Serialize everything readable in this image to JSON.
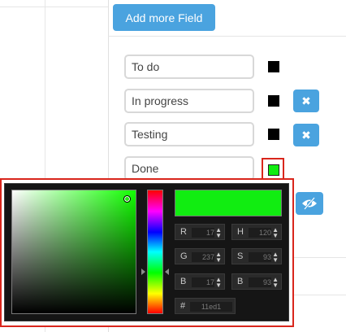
{
  "toolbar": {
    "add_field_label": "Add more Field"
  },
  "fields": [
    {
      "value": "To do",
      "color": "#000000"
    },
    {
      "value": "In progress",
      "color": "#000000"
    },
    {
      "value": "Testing",
      "color": "#000000"
    },
    {
      "value": "Done",
      "color": "#11ed11"
    }
  ],
  "icons": {
    "delete": "close-icon",
    "visibility": "eye-slash-icon"
  },
  "delete_glyph": "✖",
  "picker": {
    "preview_color": "#11ed11",
    "r": {
      "label": "R",
      "value": "17"
    },
    "g": {
      "label": "G",
      "value": "237"
    },
    "b": {
      "label": "B",
      "value": "17"
    },
    "h": {
      "label": "H",
      "value": "120"
    },
    "s": {
      "label": "S",
      "value": "93"
    },
    "bri": {
      "label": "B",
      "value": "93"
    },
    "hex": {
      "label": "#",
      "value": "11ed1"
    }
  },
  "colors": {
    "accent": "#4aa3df",
    "highlight": "#d9261c"
  }
}
